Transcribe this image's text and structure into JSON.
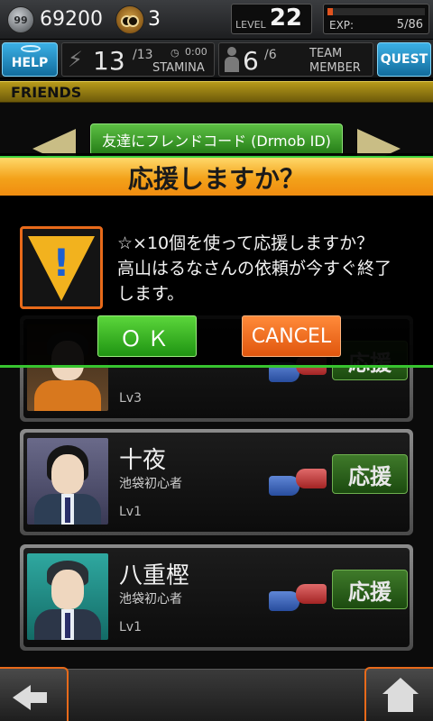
{
  "status": {
    "coin_icon_text": "99",
    "coins": "69200",
    "owls": "3",
    "level_label": "LEVEL",
    "level": "22",
    "exp_label": "EXP:",
    "exp_value": "5/86",
    "exp_fraction": 0.058
  },
  "row2": {
    "help_label": "HELP",
    "stamina_value": "13",
    "stamina_max": "/13",
    "stamina_timer": "0:00",
    "stamina_label": "STAMINA",
    "team_value": "6",
    "team_max": "/6",
    "team_label_1": "TEAM",
    "team_label_2": "MEMBER",
    "quest_label": "QUEST"
  },
  "friends": {
    "header": "FRIENDS",
    "code_button": "友達にフレンドコード (Drmob ID)"
  },
  "cards": [
    {
      "name": "",
      "title": "",
      "level": "Lv3",
      "cheer_label": "応援"
    },
    {
      "name": "十夜",
      "title": "池袋初心者",
      "level": "Lv1",
      "cheer_label": "応援"
    },
    {
      "name": "八重樫",
      "title": "池袋初心者",
      "level": "Lv1",
      "cheer_label": "応援"
    }
  ],
  "modal": {
    "title": "応援しますか？",
    "line1": "☆×10個を使って応援しますか？",
    "line2": "高山はるなさんの依頼が今すぐ終了",
    "line3": "します。",
    "ok_label": "ＯＫ",
    "cancel_label": "CANCEL"
  },
  "colors": {
    "accent_orange": "#e86a1a",
    "ok_green": "#2aa91a",
    "header_gold": "#b79a1a",
    "help_blue": "#1f87bb"
  }
}
